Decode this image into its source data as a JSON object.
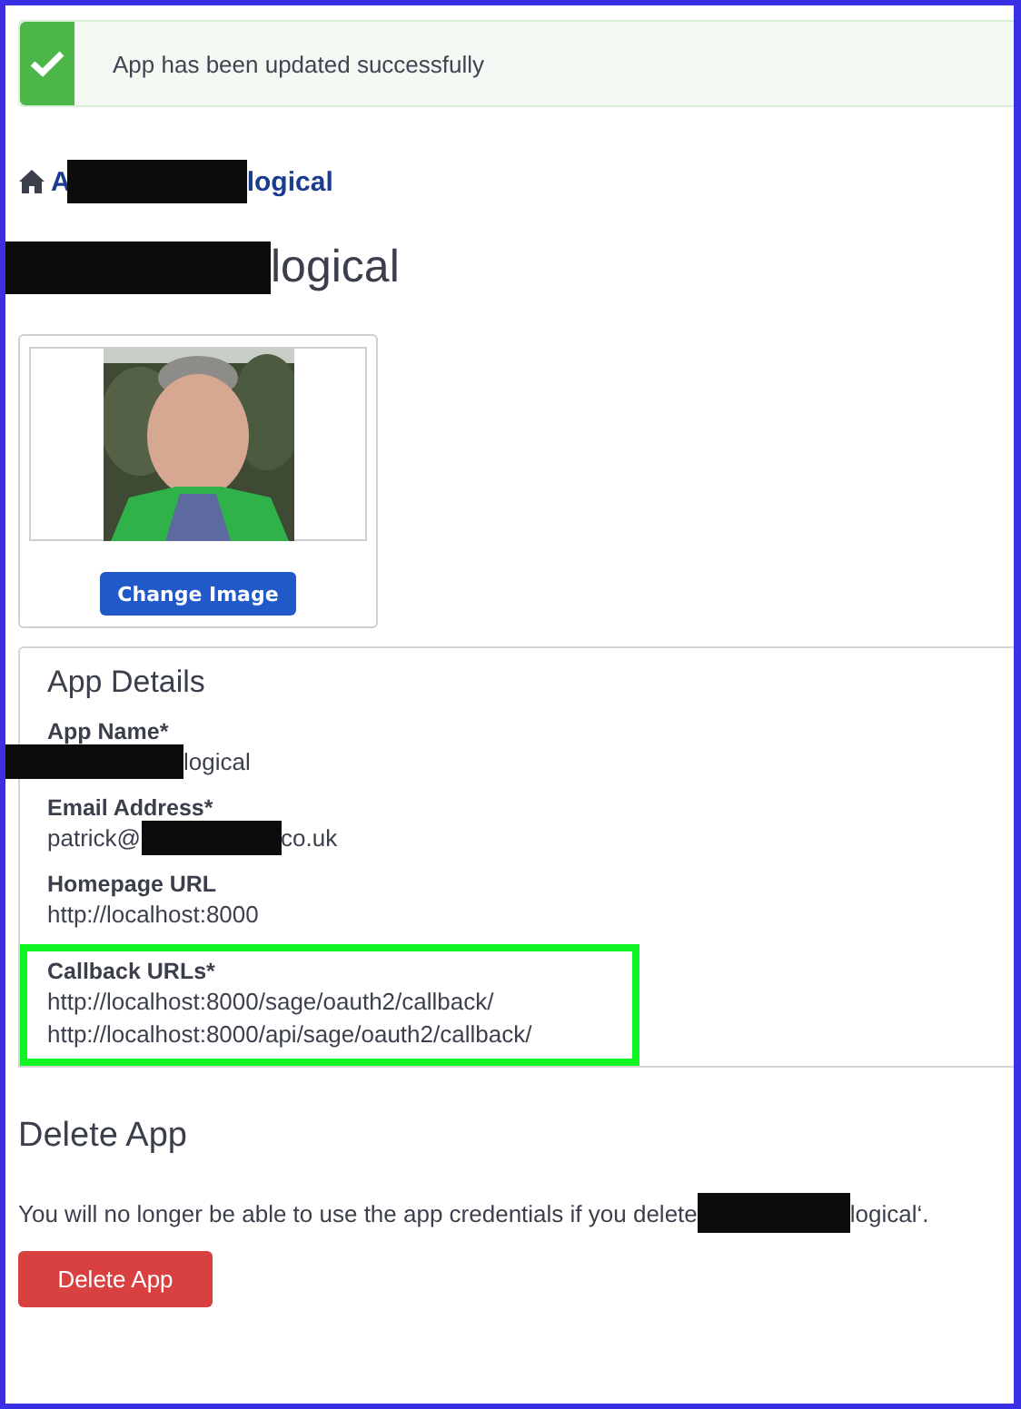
{
  "alert": {
    "kind": "success",
    "message": "App has been updated successfully"
  },
  "breadcrumb": [
    {
      "kind": "text",
      "text": "A"
    },
    {
      "kind": "redaction"
    },
    {
      "kind": "text",
      "text": "logical"
    }
  ],
  "title": [
    {
      "kind": "redaction"
    },
    {
      "kind": "text",
      "text": "logical"
    }
  ],
  "image_card": {
    "button": "Change Image"
  },
  "details": {
    "heading": "App Details",
    "fields": [
      {
        "label": "App Name*",
        "highlighted": false,
        "values": [
          [
            {
              "kind": "redaction"
            },
            {
              "kind": "text",
              "text": "logical"
            }
          ]
        ]
      },
      {
        "label": "Email Address*",
        "highlighted": false,
        "values": [
          [
            {
              "kind": "text",
              "text": "patrick@"
            },
            {
              "kind": "redaction"
            },
            {
              "kind": "text",
              "text": "co.uk"
            }
          ]
        ]
      },
      {
        "label": "Homepage URL",
        "highlighted": false,
        "values": [
          [
            {
              "kind": "text",
              "text": "http://localhost:8000"
            }
          ]
        ]
      },
      {
        "label": "Callback URLs*",
        "highlighted": true,
        "values": [
          [
            {
              "kind": "text",
              "text": "http://localhost:8000/sage/oauth2/callback/"
            }
          ],
          [
            {
              "kind": "text",
              "text": "http://localhost:8000/api/sage/oauth2/callback/"
            }
          ]
        ]
      }
    ]
  },
  "delete": {
    "heading": "Delete App",
    "text": [
      {
        "kind": "text",
        "text": "You will no longer be able to use the app credentials if you delete"
      },
      {
        "kind": "redaction"
      },
      {
        "kind": "text",
        "text": "logical‘."
      }
    ],
    "button": "Delete App"
  }
}
